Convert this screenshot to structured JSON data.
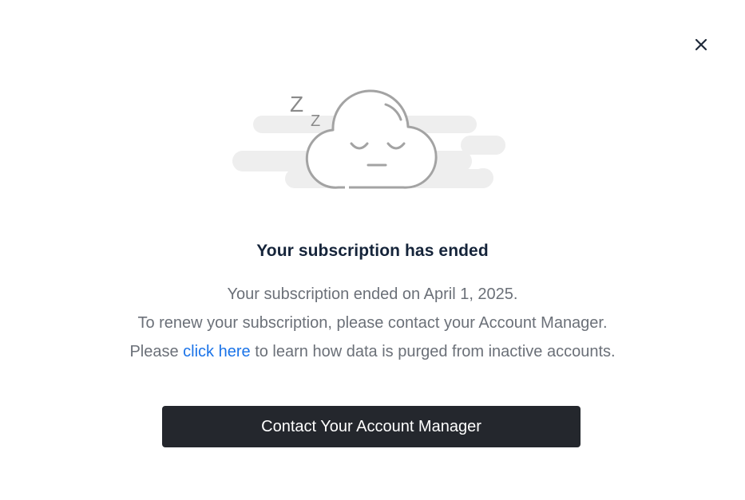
{
  "dialog": {
    "title": "Your subscription has ended",
    "message": {
      "line1": "Your subscription ended on April 1, 2025.",
      "line2": "To renew your subscription, please contact your Account Manager.",
      "line3_prefix": "Please ",
      "line3_link": "click here",
      "line3_suffix": " to learn how data is purged from inactive accounts."
    },
    "cta_label": "Contact Your Account Manager",
    "illustration": {
      "icon": "sleeping-cloud-icon",
      "zzz_large": "Z",
      "zzz_small": "Z"
    },
    "close_icon": "close-icon"
  },
  "colors": {
    "title": "#15243a",
    "body_text": "#6b7078",
    "link": "#1a73e8",
    "button_bg": "#24272d",
    "button_text": "#ffffff",
    "cloud_stroke": "#a3a3a3",
    "cloud_bg_stripes": "#eeeeee"
  }
}
